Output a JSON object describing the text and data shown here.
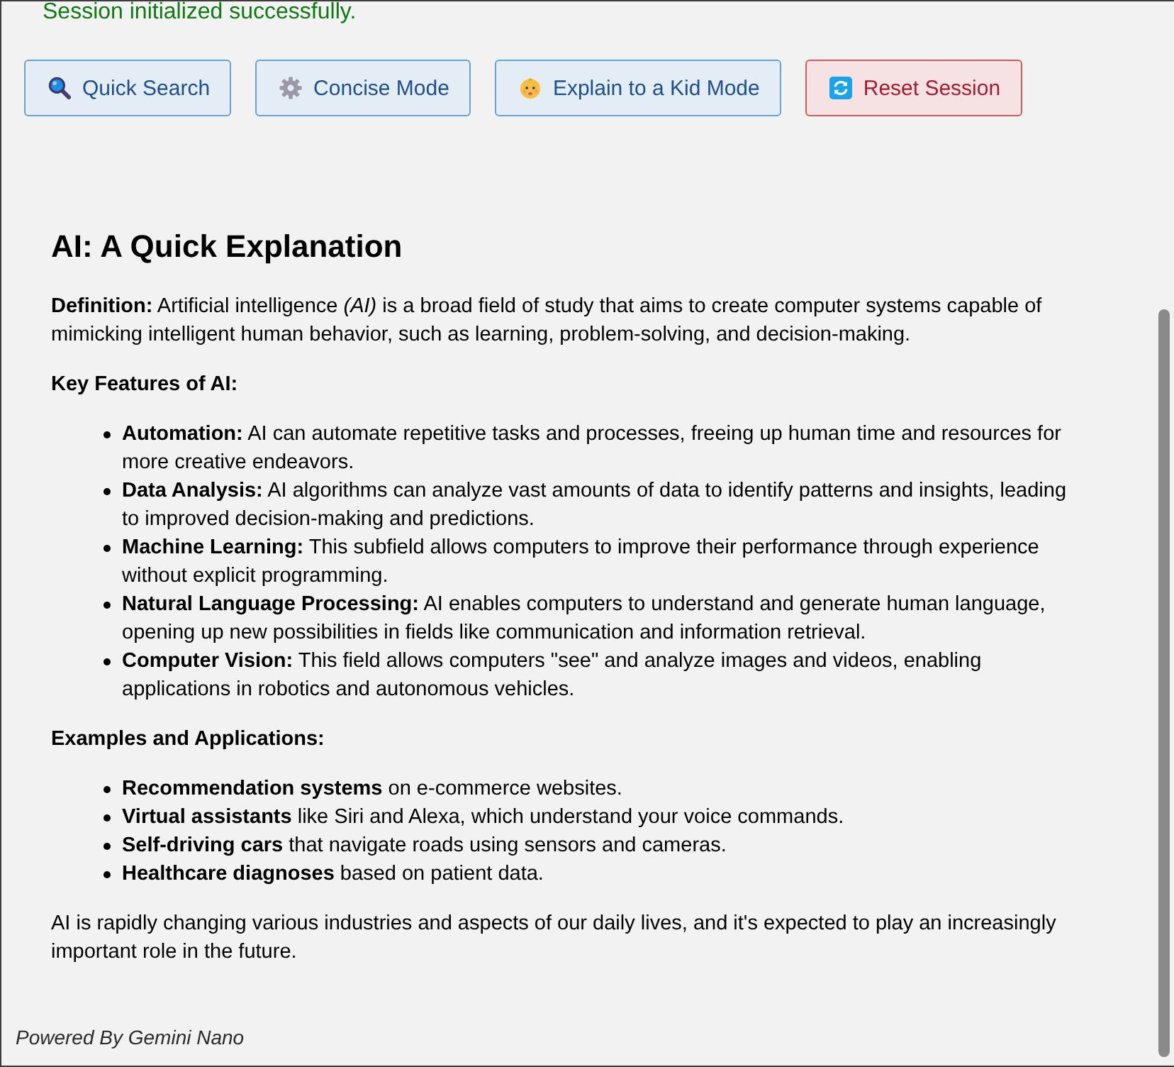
{
  "status_message": "Session initialized successfully.",
  "toolbar": [
    {
      "kind": "search",
      "label": "Quick Search"
    },
    {
      "kind": "concise",
      "label": "Concise Mode"
    },
    {
      "kind": "kid",
      "label": "Explain to a Kid Mode"
    },
    {
      "kind": "reset",
      "label": "Reset Session"
    }
  ],
  "response": {
    "title": "AI: A Quick Explanation",
    "blocks": [
      {
        "kind": "paragraph",
        "text": "**Definition:** Artificial intelligence *(AI)* is a broad field of study that aims to create computer systems capable of mimicking intelligent human behavior, such as learning, problem-solving, and decision-making."
      },
      {
        "kind": "subheading",
        "text": "Key Features of AI:"
      },
      {
        "kind": "list",
        "items": [
          "**Automation:** AI can automate repetitive tasks and processes, freeing up human time and resources for more creative endeavors.",
          "**Data Analysis:** AI algorithms can analyze vast amounts of data to identify patterns and insights, leading to improved decision-making and predictions.",
          "**Machine Learning:** This subfield allows computers to improve their performance through experience without explicit programming.",
          "**Natural Language Processing:** AI enables computers to understand and generate human language, opening up new possibilities in fields like communication and information retrieval.",
          "**Computer Vision:** This field allows computers \"see\" and analyze images and videos, enabling applications in robotics and autonomous vehicles."
        ]
      },
      {
        "kind": "subheading",
        "text": "Examples and Applications:"
      },
      {
        "kind": "list",
        "items": [
          "**Recommendation systems** on e-commerce websites.",
          "**Virtual assistants** like Siri and Alexa, which understand your voice commands.",
          "**Self-driving cars** that navigate roads using sensors and cameras.",
          "**Healthcare diagnoses** based on patient data."
        ]
      },
      {
        "kind": "paragraph",
        "text": "AI is rapidly changing various industries and aspects of our daily lives, and it's expected to play an increasingly important role in the future."
      }
    ]
  },
  "footer": "Powered By Gemini Nano"
}
